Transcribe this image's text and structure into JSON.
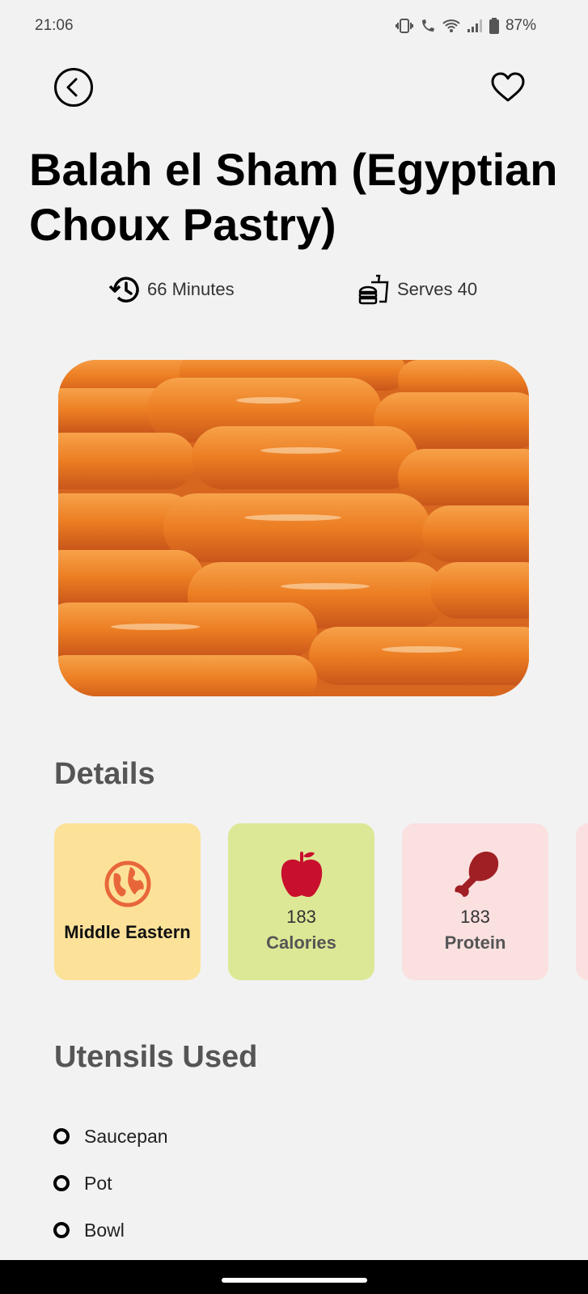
{
  "status_bar": {
    "time": "21:06",
    "battery": "87%",
    "icons": [
      "vibrate-icon",
      "wifi-call-icon",
      "wifi-icon",
      "signal-icon",
      "battery-icon"
    ]
  },
  "nav": {
    "back_icon": "back-arrow-icon",
    "favorite_icon": "heart-icon"
  },
  "recipe": {
    "title": "Balah el Sham (Egyptian Choux Pastry)",
    "time": "66 Minutes",
    "serves": "Serves 40",
    "time_icon": "history-clock-icon",
    "serves_icon": "fast-food-icon",
    "image_alt": "Fried syrup-soaked choux pastry fingers"
  },
  "details": {
    "title": "Details",
    "cards": [
      {
        "icon": "globe-icon",
        "label": "Middle Eastern",
        "color": "#fce299",
        "icon_color": "#e8673a"
      },
      {
        "icon": "apple-icon",
        "value": "183",
        "label": "Calories",
        "color": "#dde896",
        "icon_color": "#c8102e"
      },
      {
        "icon": "chicken-leg-icon",
        "value": "183",
        "label": "Protein",
        "color": "#fbe0e0",
        "icon_color": "#a01f24"
      }
    ]
  },
  "utensils": {
    "title": "Utensils Used",
    "items": [
      "Saucepan",
      "Pot",
      "Bowl"
    ]
  }
}
